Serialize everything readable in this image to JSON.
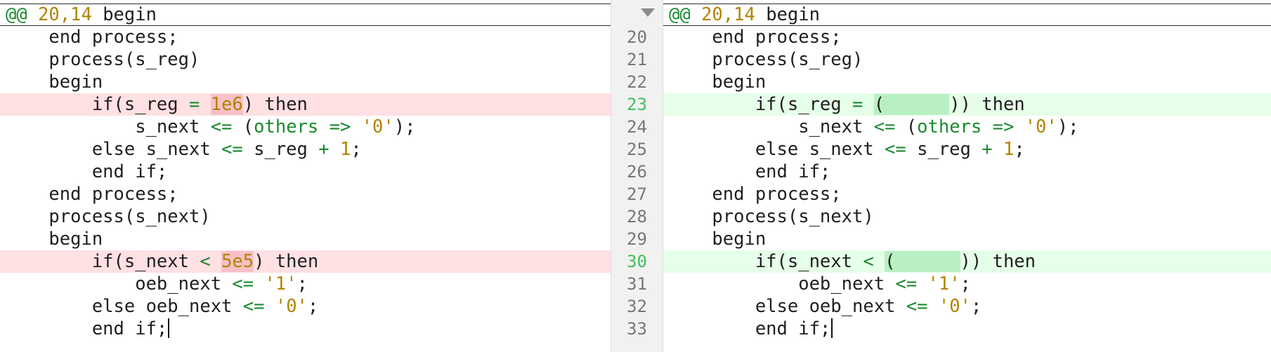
{
  "hunk_header": {
    "marker": "@@",
    "range": "20,14",
    "label": " begin"
  },
  "line_numbers": [
    "20",
    "21",
    "22",
    "23",
    "24",
    "25",
    "26",
    "27",
    "28",
    "29",
    "30",
    "31",
    "32",
    "33"
  ],
  "left": {
    "lines": [
      {
        "state": "ctx",
        "segments": [
          {
            "t": "    end process;",
            "c": "id"
          }
        ]
      },
      {
        "state": "ctx",
        "segments": [
          {
            "t": "    process(s_reg)",
            "c": "id"
          }
        ]
      },
      {
        "state": "ctx",
        "segments": [
          {
            "t": "    begin",
            "c": "id"
          }
        ]
      },
      {
        "state": "del",
        "segments": [
          {
            "t": "        if(s_reg ",
            "c": "id"
          },
          {
            "t": "=",
            "c": "op"
          },
          {
            "t": " ",
            "c": "id"
          },
          {
            "t": "1e6",
            "c": "hl-del"
          },
          {
            "t": ") then",
            "c": "id"
          }
        ]
      },
      {
        "state": "ctx",
        "segments": [
          {
            "t": "            s_next ",
            "c": "id"
          },
          {
            "t": "<=",
            "c": "op"
          },
          {
            "t": " (",
            "c": "id"
          },
          {
            "t": "others",
            "c": "fn"
          },
          {
            "t": " ",
            "c": "id"
          },
          {
            "t": "=>",
            "c": "op"
          },
          {
            "t": " ",
            "c": "id"
          },
          {
            "t": "'0'",
            "c": "str"
          },
          {
            "t": ");",
            "c": "id"
          }
        ]
      },
      {
        "state": "ctx",
        "segments": [
          {
            "t": "        else s_next ",
            "c": "id"
          },
          {
            "t": "<=",
            "c": "op"
          },
          {
            "t": " s_reg ",
            "c": "id"
          },
          {
            "t": "+",
            "c": "op"
          },
          {
            "t": " ",
            "c": "id"
          },
          {
            "t": "1",
            "c": "num"
          },
          {
            "t": ";",
            "c": "id"
          }
        ]
      },
      {
        "state": "ctx",
        "segments": [
          {
            "t": "        end if;",
            "c": "id"
          }
        ]
      },
      {
        "state": "ctx",
        "segments": [
          {
            "t": "    end process;",
            "c": "id"
          }
        ]
      },
      {
        "state": "ctx",
        "segments": [
          {
            "t": "    process(s_next)",
            "c": "id"
          }
        ]
      },
      {
        "state": "ctx",
        "segments": [
          {
            "t": "    begin",
            "c": "id"
          }
        ]
      },
      {
        "state": "del",
        "segments": [
          {
            "t": "        if(s_next ",
            "c": "id"
          },
          {
            "t": "<",
            "c": "op"
          },
          {
            "t": " ",
            "c": "id"
          },
          {
            "t": "5e5",
            "c": "hl-del"
          },
          {
            "t": ") then",
            "c": "id"
          }
        ]
      },
      {
        "state": "ctx",
        "segments": [
          {
            "t": "            oeb_next ",
            "c": "id"
          },
          {
            "t": "<=",
            "c": "op"
          },
          {
            "t": " ",
            "c": "id"
          },
          {
            "t": "'1'",
            "c": "str"
          },
          {
            "t": ";",
            "c": "id"
          }
        ]
      },
      {
        "state": "ctx",
        "segments": [
          {
            "t": "        else oeb_next ",
            "c": "id"
          },
          {
            "t": "<=",
            "c": "op"
          },
          {
            "t": " ",
            "c": "id"
          },
          {
            "t": "'0'",
            "c": "str"
          },
          {
            "t": ";",
            "c": "id"
          }
        ]
      },
      {
        "state": "ctx",
        "cursor": true,
        "segments": [
          {
            "t": "        end if;",
            "c": "id"
          }
        ]
      }
    ]
  },
  "right": {
    "lines": [
      {
        "state": "ctx",
        "segments": [
          {
            "t": "    end process;",
            "c": "id"
          }
        ]
      },
      {
        "state": "ctx",
        "segments": [
          {
            "t": "    process(s_reg)",
            "c": "id"
          }
        ]
      },
      {
        "state": "ctx",
        "segments": [
          {
            "t": "    begin",
            "c": "id"
          }
        ]
      },
      {
        "state": "add",
        "segments": [
          {
            "t": "        if(s_reg ",
            "c": "id"
          },
          {
            "t": "=",
            "c": "op"
          },
          {
            "t": " ",
            "c": "id"
          },
          {
            "t": "(      ",
            "c": "hl-add"
          },
          {
            "t": ")) then",
            "c": "id"
          }
        ]
      },
      {
        "state": "ctx",
        "segments": [
          {
            "t": "            s_next ",
            "c": "id"
          },
          {
            "t": "<=",
            "c": "op"
          },
          {
            "t": " (",
            "c": "id"
          },
          {
            "t": "others",
            "c": "fn"
          },
          {
            "t": " ",
            "c": "id"
          },
          {
            "t": "=>",
            "c": "op"
          },
          {
            "t": " ",
            "c": "id"
          },
          {
            "t": "'0'",
            "c": "str"
          },
          {
            "t": ");",
            "c": "id"
          }
        ]
      },
      {
        "state": "ctx",
        "segments": [
          {
            "t": "        else s_next ",
            "c": "id"
          },
          {
            "t": "<=",
            "c": "op"
          },
          {
            "t": " s_reg ",
            "c": "id"
          },
          {
            "t": "+",
            "c": "op"
          },
          {
            "t": " ",
            "c": "id"
          },
          {
            "t": "1",
            "c": "num"
          },
          {
            "t": ";",
            "c": "id"
          }
        ]
      },
      {
        "state": "ctx",
        "segments": [
          {
            "t": "        end if;",
            "c": "id"
          }
        ]
      },
      {
        "state": "ctx",
        "segments": [
          {
            "t": "    end process;",
            "c": "id"
          }
        ]
      },
      {
        "state": "ctx",
        "segments": [
          {
            "t": "    process(s_next)",
            "c": "id"
          }
        ]
      },
      {
        "state": "ctx",
        "segments": [
          {
            "t": "    begin",
            "c": "id"
          }
        ]
      },
      {
        "state": "add",
        "segments": [
          {
            "t": "        if(s_next ",
            "c": "id"
          },
          {
            "t": "<",
            "c": "op"
          },
          {
            "t": " ",
            "c": "id"
          },
          {
            "t": "(      ",
            "c": "hl-add"
          },
          {
            "t": ")) then",
            "c": "id"
          }
        ]
      },
      {
        "state": "ctx",
        "segments": [
          {
            "t": "            oeb_next ",
            "c": "id"
          },
          {
            "t": "<=",
            "c": "op"
          },
          {
            "t": " ",
            "c": "id"
          },
          {
            "t": "'1'",
            "c": "str"
          },
          {
            "t": ";",
            "c": "id"
          }
        ]
      },
      {
        "state": "ctx",
        "segments": [
          {
            "t": "        else oeb_next ",
            "c": "id"
          },
          {
            "t": "<=",
            "c": "op"
          },
          {
            "t": " ",
            "c": "id"
          },
          {
            "t": "'0'",
            "c": "str"
          },
          {
            "t": ";",
            "c": "id"
          }
        ]
      },
      {
        "state": "ctx",
        "cursor": true,
        "segments": [
          {
            "t": "        end if;",
            "c": "id"
          }
        ]
      }
    ]
  },
  "changed_line_numbers": [
    "23",
    "30"
  ],
  "gutter_icon": "collapse-chevron-icon"
}
